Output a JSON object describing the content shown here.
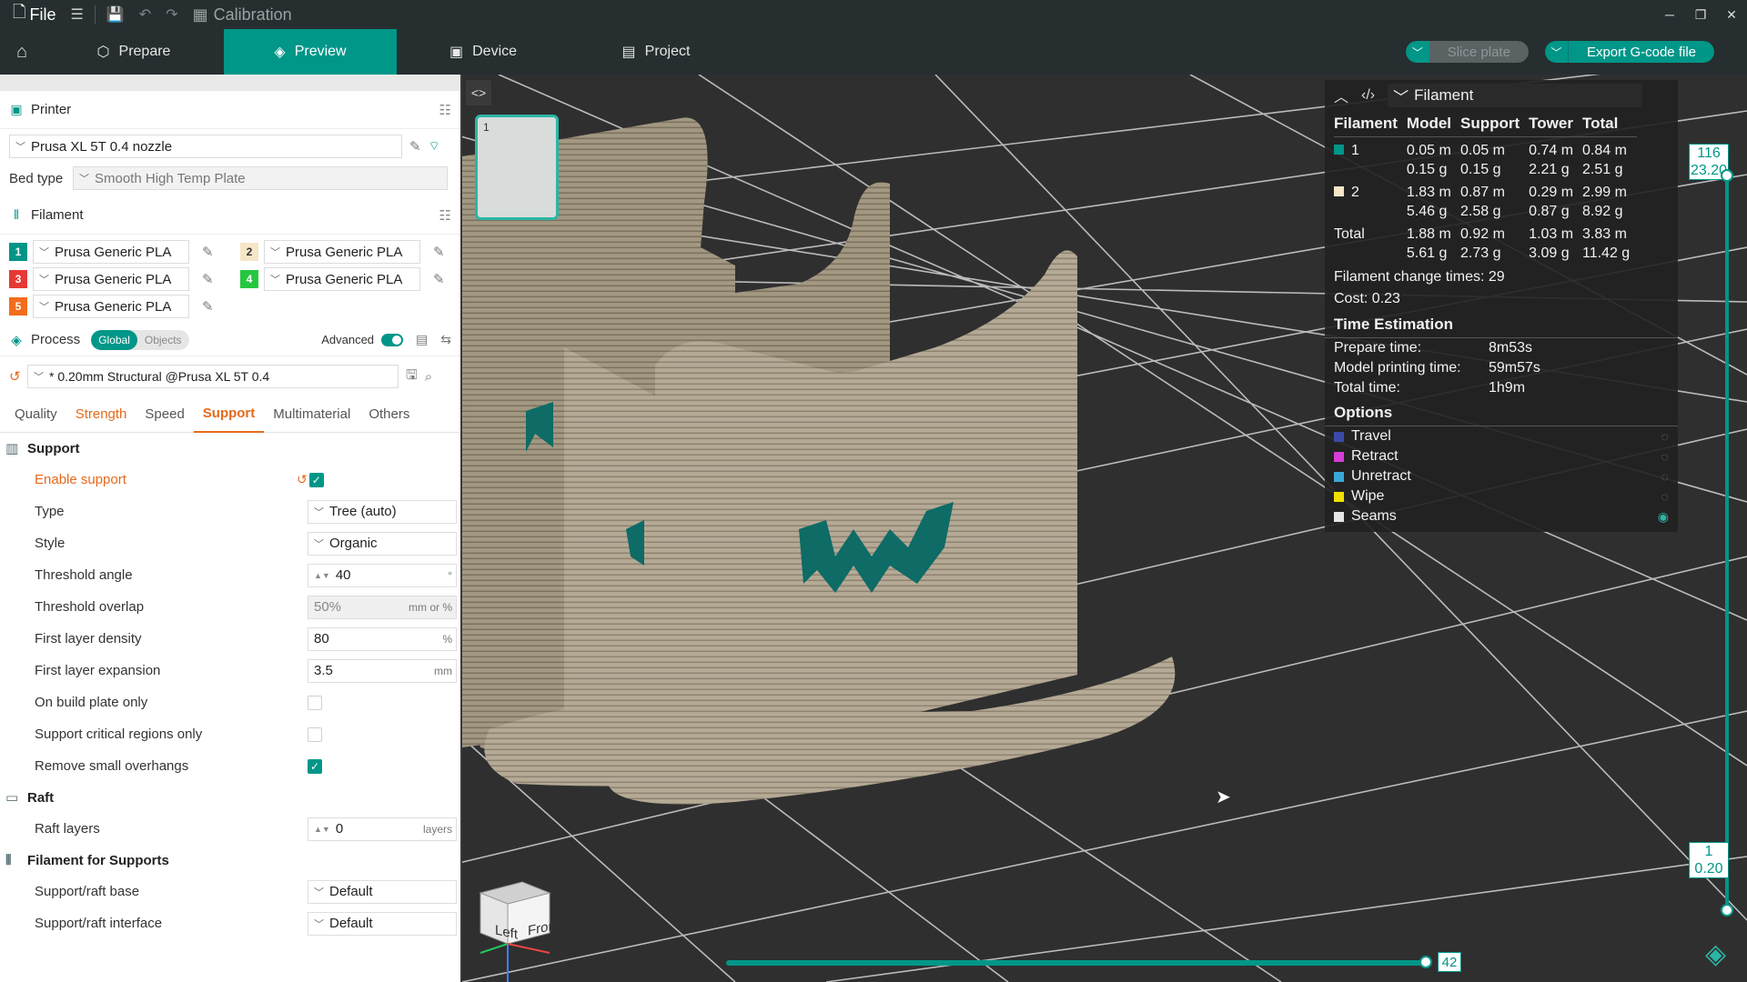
{
  "titlebar": {
    "file_label": "File",
    "title": "Calibration"
  },
  "nav": {
    "tabs": [
      {
        "label": "Prepare",
        "active": false
      },
      {
        "label": "Preview",
        "active": true
      },
      {
        "label": "Device",
        "active": false
      },
      {
        "label": "Project",
        "active": false
      }
    ],
    "slice_label": "Slice plate",
    "export_label": "Export G-code file"
  },
  "printer": {
    "section_title": "Printer",
    "preset": "Prusa XL 5T 0.4 nozzle",
    "bed_type_label": "Bed type",
    "bed_type": "Smooth High Temp Plate"
  },
  "filament": {
    "section_title": "Filament",
    "items": [
      {
        "num": "1",
        "color": "#009688",
        "name": "Prusa Generic PLA"
      },
      {
        "num": "2",
        "color": "#f5e6c8",
        "name": "Prusa Generic PLA"
      },
      {
        "num": "3",
        "color": "#e53935",
        "name": "Prusa Generic PLA"
      },
      {
        "num": "4",
        "color": "#26c740",
        "name": "Prusa Generic PLA"
      },
      {
        "num": "5",
        "color": "#f26c1c",
        "name": "Prusa Generic PLA"
      }
    ]
  },
  "process": {
    "section_title": "Process",
    "global_label": "Global",
    "objects_label": "Objects",
    "advanced_label": "Advanced",
    "preset": "* 0.20mm Structural @Prusa XL 5T 0.4",
    "tabs": [
      "Quality",
      "Strength",
      "Speed",
      "Support",
      "Multimaterial",
      "Others"
    ]
  },
  "support": {
    "group_title": "Support",
    "enable_label": "Enable support",
    "type_label": "Type",
    "type_value": "Tree (auto)",
    "style_label": "Style",
    "style_value": "Organic",
    "threshold_angle_label": "Threshold angle",
    "threshold_angle_value": "40",
    "threshold_angle_unit": "°",
    "threshold_overlap_label": "Threshold overlap",
    "threshold_overlap_value": "50%",
    "threshold_overlap_unit": "mm or %",
    "first_layer_density_label": "First layer density",
    "first_layer_density_value": "80",
    "first_layer_density_unit": "%",
    "first_layer_expansion_label": "First layer expansion",
    "first_layer_expansion_value": "3.5",
    "first_layer_expansion_unit": "mm",
    "build_plate_only_label": "On build plate only",
    "critical_regions_label": "Support critical regions only",
    "remove_overhangs_label": "Remove small overhangs"
  },
  "raft": {
    "group_title": "Raft",
    "layers_label": "Raft layers",
    "layers_value": "0",
    "layers_unit": "layers"
  },
  "fil_supports": {
    "group_title": "Filament for Supports",
    "base_label": "Support/raft base",
    "base_value": "Default",
    "interface_label": "Support/raft interface",
    "interface_value": "Default"
  },
  "stats": {
    "view_mode": "Filament",
    "headers": [
      "Filament",
      "Model",
      "Support",
      "Tower",
      "Total"
    ],
    "rows": [
      {
        "label": "1",
        "color": "#009688",
        "model": [
          "0.05 m",
          "0.15 g"
        ],
        "support": [
          "0.05 m",
          "0.15 g"
        ],
        "tower": [
          "0.74 m",
          "2.21 g"
        ],
        "total": [
          "0.84 m",
          "2.51 g"
        ]
      },
      {
        "label": "2",
        "color": "#f5e6c8",
        "model": [
          "1.83 m",
          "5.46 g"
        ],
        "support": [
          "0.87 m",
          "2.58 g"
        ],
        "tower": [
          "0.29 m",
          "0.87 g"
        ],
        "total": [
          "2.99 m",
          "8.92 g"
        ]
      }
    ],
    "total_row": {
      "label": "Total",
      "model": [
        "1.88 m",
        "5.61 g"
      ],
      "support": [
        "0.92 m",
        "2.73 g"
      ],
      "tower": [
        "1.03 m",
        "3.09 g"
      ],
      "total": [
        "3.83 m",
        "11.42 g"
      ]
    },
    "change_times": "Filament change times:  29",
    "cost": "Cost:  0.23",
    "time_title": "Time Estimation",
    "prepare_label": "Prepare time:",
    "prepare_value": "8m53s",
    "model_time_label": "Model printing time:",
    "model_time_value": "59m57s",
    "total_time_label": "Total time:",
    "total_time_value": "1h9m",
    "options_title": "Options",
    "options": [
      {
        "label": "Travel",
        "color": "#3b4aa8",
        "visible": false
      },
      {
        "label": "Retract",
        "color": "#d63cd6",
        "visible": false
      },
      {
        "label": "Unretract",
        "color": "#3ba9d6",
        "visible": false
      },
      {
        "label": "Wipe",
        "color": "#f0e000",
        "visible": false
      },
      {
        "label": "Seams",
        "color": "#e6e6e6",
        "visible": true
      }
    ]
  },
  "layer_slider": {
    "top_layer": "116",
    "top_height": "23.20",
    "bottom_layer": "1",
    "bottom_height": "0.20"
  },
  "move_slider": {
    "value": "42"
  },
  "navcube": {
    "left": "Left",
    "front": "Front"
  },
  "plate": {
    "number": "1"
  },
  "colors": {
    "accent": "#009688",
    "modified": "#e56a1c",
    "model": "#b8ad98",
    "logo": "#0e6b66"
  }
}
